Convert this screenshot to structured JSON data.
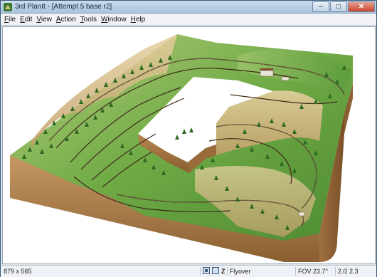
{
  "window": {
    "title": "3rd PlanIt - [Attempt 5 base r2]",
    "buttons": {
      "minimize": "–",
      "maximize": "□",
      "close": "✕"
    }
  },
  "menubar": {
    "items": [
      {
        "label": "File",
        "key": "F",
        "rest": "ile"
      },
      {
        "label": "Edit",
        "key": "E",
        "rest": "dit"
      },
      {
        "label": "View",
        "key": "V",
        "rest": "iew"
      },
      {
        "label": "Action",
        "key": "A",
        "rest": "ction"
      },
      {
        "label": "Tools",
        "key": "T",
        "rest": "ools"
      },
      {
        "label": "Window",
        "key": "W",
        "rest": "indow"
      },
      {
        "label": "Help",
        "key": "H",
        "rest": "elp"
      }
    ]
  },
  "toolbar": {
    "icons": [
      "grid-select-icon",
      "snap-icon",
      "camera-icon",
      "refresh-icon",
      "track-piece-icon",
      "switch-icon",
      "turnout-icon",
      "crossing-icon",
      "flex-track-icon",
      "block-icon",
      "table-icon",
      "layer-icon",
      "line-tool-icon",
      "pencil-icon",
      "signal-icon",
      "track-tool-icon"
    ]
  },
  "status": {
    "size": "879 x 565",
    "z_label": "Z",
    "mode": "Flyover",
    "fov": "FOV  23.7°",
    "v1": "2.0",
    "v2": "2.3"
  },
  "colors": {
    "ground": "#a97a45",
    "grass": "#5f9b3c",
    "track": "#4a3320",
    "tree": "#2f6a22"
  }
}
